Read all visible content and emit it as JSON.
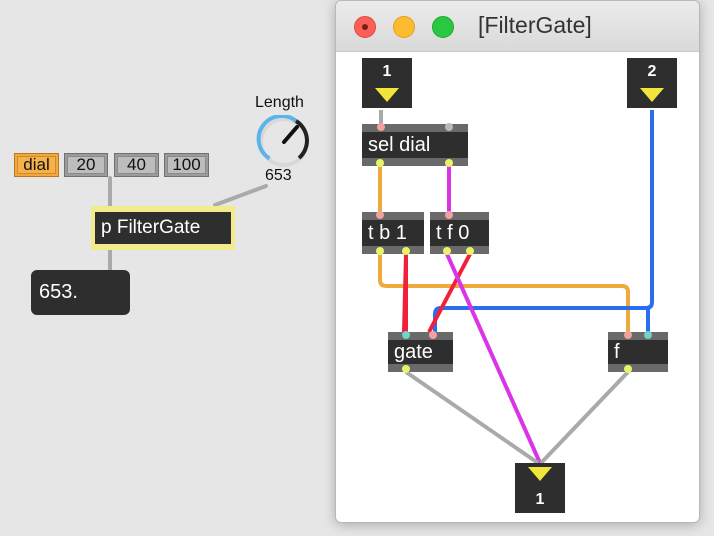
{
  "main_patcher": {
    "messages": [
      "dial",
      "20",
      "40",
      "100"
    ],
    "subpatch_label": "p FilterGate",
    "number_box_value": "653.",
    "dial": {
      "title": "Length",
      "value": "653",
      "level": 0.6
    }
  },
  "window": {
    "title": "[FilterGate]",
    "inlet_1": "1",
    "inlet_2": "2",
    "sel_label": "sel dial",
    "tb_label": "t b 1",
    "tf_label": "t f 0",
    "gate_label": "gate",
    "f_label": "f",
    "outlet_1": "1"
  },
  "colors": {
    "background": "#e6e6e6",
    "object": "#2e2e2e",
    "orange_cord": "#f0a93c",
    "purple_cord": "#d934e8",
    "red_cord": "#f0203a",
    "blue_cord": "#2a6ef0",
    "grey_cord": "#aaaaaa",
    "dial_arc": "#5ab4ea"
  }
}
